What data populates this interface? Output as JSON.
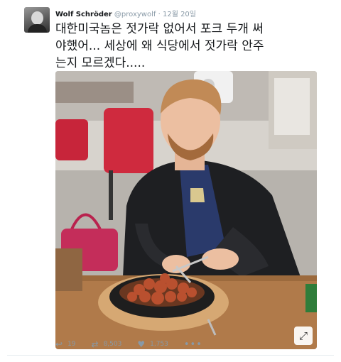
{
  "tweet": {
    "display_name": "Wolf Schröder",
    "handle": "@proxywolf",
    "separator": "·",
    "date": "12월 20일",
    "text_lines": [
      "대한미국놈은 젓가락 없어서 포크 두개 써",
      "야했어... 세상에 왜 식당에서 젓가락 안주",
      "는지 모르겠다....."
    ]
  },
  "actions": {
    "reply": {
      "icon": "reply-icon",
      "count": "19"
    },
    "retweet": {
      "icon": "retweet-icon",
      "count": "8,503"
    },
    "like": {
      "icon": "heart-icon",
      "count": "1,753"
    },
    "more": "•••"
  },
  "colors": {
    "text": "#14171a",
    "muted": "#8899a6"
  }
}
